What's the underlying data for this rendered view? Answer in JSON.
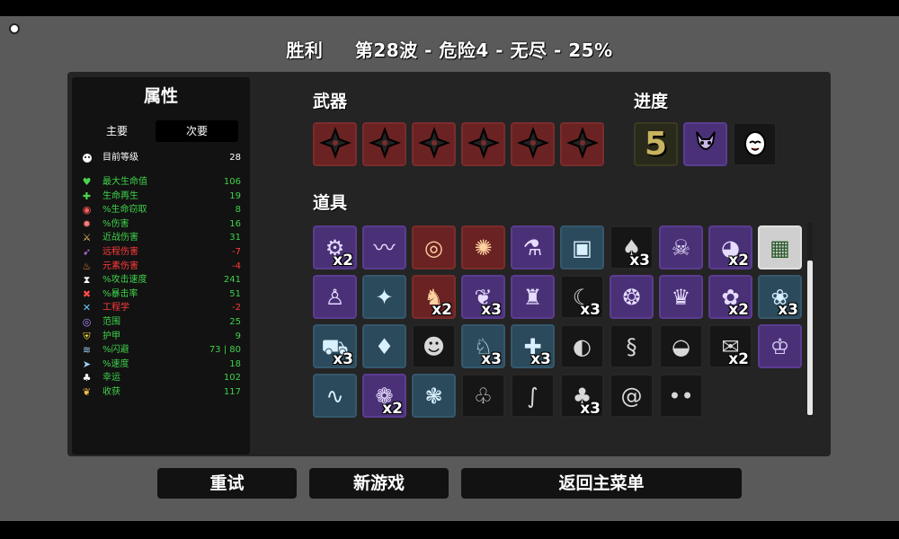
{
  "header": {
    "result": "胜利",
    "run_info": "第28波 - 危险4 - 无尽 - 25%"
  },
  "stats": {
    "title": "属性",
    "tabs": [
      "主要",
      "次要"
    ],
    "level": {
      "label": "目前等级",
      "value": "28"
    },
    "rows": [
      {
        "label": "最大生命值",
        "value": "106",
        "color": "#3fd14a",
        "icon": "heart-icon"
      },
      {
        "label": "生命再生",
        "value": "19",
        "color": "#3fd14a",
        "icon": "regen-icon"
      },
      {
        "label": "%生命窃取",
        "value": "8",
        "color": "#3fd14a",
        "icon": "lifesteal-icon"
      },
      {
        "label": "%伤害",
        "value": "16",
        "color": "#3fd14a",
        "icon": "damage-icon"
      },
      {
        "label": "近战伤害",
        "value": "31",
        "color": "#3fd14a",
        "icon": "melee-icon"
      },
      {
        "label": "远程伤害",
        "value": "-7",
        "color": "#ff3b3b",
        "icon": "ranged-icon"
      },
      {
        "label": "元素伤害",
        "value": "-4",
        "color": "#ff3b3b",
        "icon": "elemental-icon"
      },
      {
        "label": "%攻击速度",
        "value": "241",
        "color": "#3fd14a",
        "icon": "attack-speed-icon"
      },
      {
        "label": "%暴击率",
        "value": "51",
        "color": "#3fd14a",
        "icon": "crit-icon"
      },
      {
        "label": "工程学",
        "value": "-2",
        "color": "#ff3b3b",
        "icon": "engineering-icon"
      },
      {
        "label": "范围",
        "value": "25",
        "color": "#3fd14a",
        "icon": "range-icon"
      },
      {
        "label": "护甲",
        "value": "9",
        "color": "#3fd14a",
        "icon": "armor-icon"
      },
      {
        "label": "%闪避",
        "value": "73 | 80",
        "color": "#3fd14a",
        "icon": "dodge-icon"
      },
      {
        "label": "%速度",
        "value": "18",
        "color": "#3fd14a",
        "icon": "speed-icon"
      },
      {
        "label": "幸运",
        "value": "102",
        "color": "#3fd14a",
        "icon": "luck-icon"
      },
      {
        "label": "收获",
        "value": "117",
        "color": "#3fd14a",
        "icon": "harvest-icon"
      }
    ]
  },
  "weapons": {
    "title": "武器",
    "slots": [
      "shuriken-icon",
      "shuriken-icon",
      "shuriken-icon",
      "shuriken-icon",
      "shuriken-icon",
      "shuriken-icon"
    ]
  },
  "progress": {
    "title": "进度",
    "wave_number": "5",
    "slots": [
      "number-five-icon",
      "demon-mask-icon",
      "egg-icon"
    ]
  },
  "items": {
    "title": "道具",
    "list": [
      {
        "icon": "turret-icon",
        "tier": "purple",
        "count": "x2"
      },
      {
        "icon": "scarf-icon",
        "tier": "purple",
        "count": ""
      },
      {
        "icon": "coin-icon",
        "tier": "red",
        "count": ""
      },
      {
        "icon": "snowflake-icon",
        "tier": "red",
        "count": ""
      },
      {
        "icon": "potion-icon",
        "tier": "purple",
        "count": ""
      },
      {
        "icon": "armor-plate-icon",
        "tier": "blue",
        "count": ""
      },
      {
        "icon": "mushroom-icon",
        "tier": "black",
        "count": "x3"
      },
      {
        "icon": "skull-mask-icon",
        "tier": "purple",
        "count": ""
      },
      {
        "icon": "alien-icon",
        "tier": "purple",
        "count": "x2"
      },
      {
        "icon": "machine-icon",
        "tier": "white",
        "count": ""
      },
      {
        "icon": "statue-icon",
        "tier": "purple",
        "count": ""
      },
      {
        "icon": "claw-icon",
        "tier": "blue",
        "count": ""
      },
      {
        "icon": "mammoth-icon",
        "tier": "red",
        "count": "x2"
      },
      {
        "icon": "wings-icon",
        "tier": "purple",
        "count": "x3"
      },
      {
        "icon": "hoodie-icon",
        "tier": "purple",
        "count": ""
      },
      {
        "icon": "scythe-icon",
        "tier": "black",
        "count": "x3"
      },
      {
        "icon": "peacock-icon",
        "tier": "purple",
        "count": ""
      },
      {
        "icon": "ghost-icon",
        "tier": "purple",
        "count": ""
      },
      {
        "icon": "tardigrade-icon",
        "tier": "purple",
        "count": "x2"
      },
      {
        "icon": "pet-icon",
        "tier": "blue",
        "count": "x3"
      },
      {
        "icon": "wheelbarrow-icon",
        "tier": "blue",
        "count": "x3"
      },
      {
        "icon": "ketchup-icon",
        "tier": "blue",
        "count": ""
      },
      {
        "icon": "monkey-icon",
        "tier": "black",
        "count": ""
      },
      {
        "icon": "rabbit-icon",
        "tier": "blue",
        "count": "x3"
      },
      {
        "icon": "medkit-icon",
        "tier": "blue",
        "count": "x3"
      },
      {
        "icon": "bird-skull-icon",
        "tier": "black",
        "count": ""
      },
      {
        "icon": "snake-icon",
        "tier": "black",
        "count": ""
      },
      {
        "icon": "bandage-icon",
        "tier": "black",
        "count": ""
      },
      {
        "icon": "cash-icon",
        "tier": "black",
        "count": "x2"
      },
      {
        "icon": "crown-icon",
        "tier": "purple",
        "count": ""
      },
      {
        "icon": "worm-icon",
        "tier": "blue",
        "count": ""
      },
      {
        "icon": "brain-icon",
        "tier": "purple",
        "count": "x2"
      },
      {
        "icon": "pig-icon",
        "tier": "blue",
        "count": ""
      },
      {
        "icon": "flamingo-icon",
        "tier": "black",
        "count": ""
      },
      {
        "icon": "eel-icon",
        "tier": "black",
        "count": ""
      },
      {
        "icon": "tree-icon",
        "tier": "black",
        "count": "x3"
      },
      {
        "icon": "spiral-icon",
        "tier": "black",
        "count": ""
      },
      {
        "icon": "eyes-icon",
        "tier": "black",
        "count": ""
      }
    ]
  },
  "buttons": {
    "retry": "重试",
    "new_game": "新游戏",
    "main_menu": "返回主菜单"
  }
}
